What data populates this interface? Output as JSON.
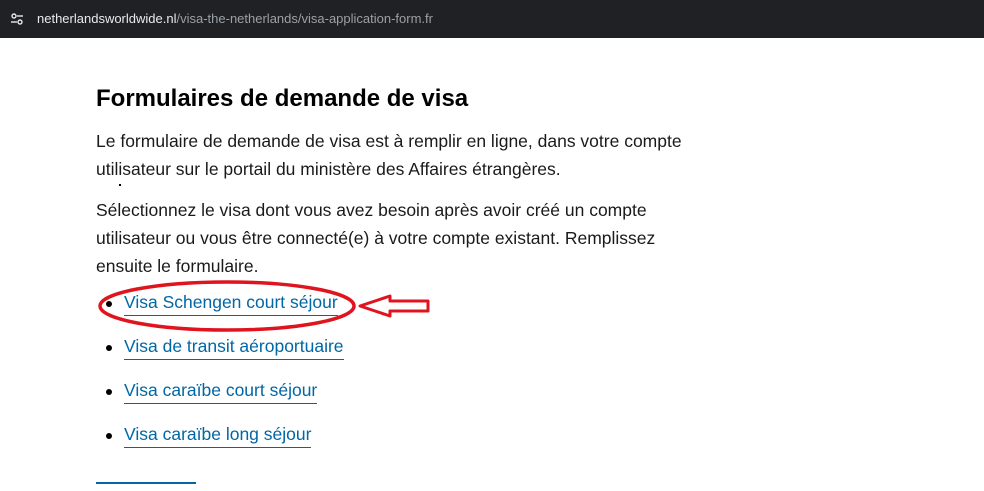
{
  "browser": {
    "url_domain": "netherlandsworldwide.nl",
    "url_path": "/visa-the-netherlands/visa-application-form.fr",
    "site_icon": "tune-icon"
  },
  "main": {
    "title": "Formulaires de demande de visa",
    "paragraph1": "Le formulaire de demande de visa est à remplir en ligne, dans votre compte utilisateur sur le portail du ministère des Affaires étrangères.",
    "paragraph2": "Sélectionnez le visa dont vous avez besoin après avoir créé un compte utilisateur ou vous être connecté(e) à votre compte existant. Remplissez ensuite le formulaire.",
    "links": [
      {
        "label": "Visa Schengen court séjour"
      },
      {
        "label": "Visa de transit aéroportuaire"
      },
      {
        "label": "Visa caraïbe court séjour"
      },
      {
        "label": "Visa caraïbe long séjour"
      }
    ]
  },
  "colors": {
    "link": "#0066a6",
    "annotation": "#e0141e",
    "addressbar": "#202124"
  }
}
